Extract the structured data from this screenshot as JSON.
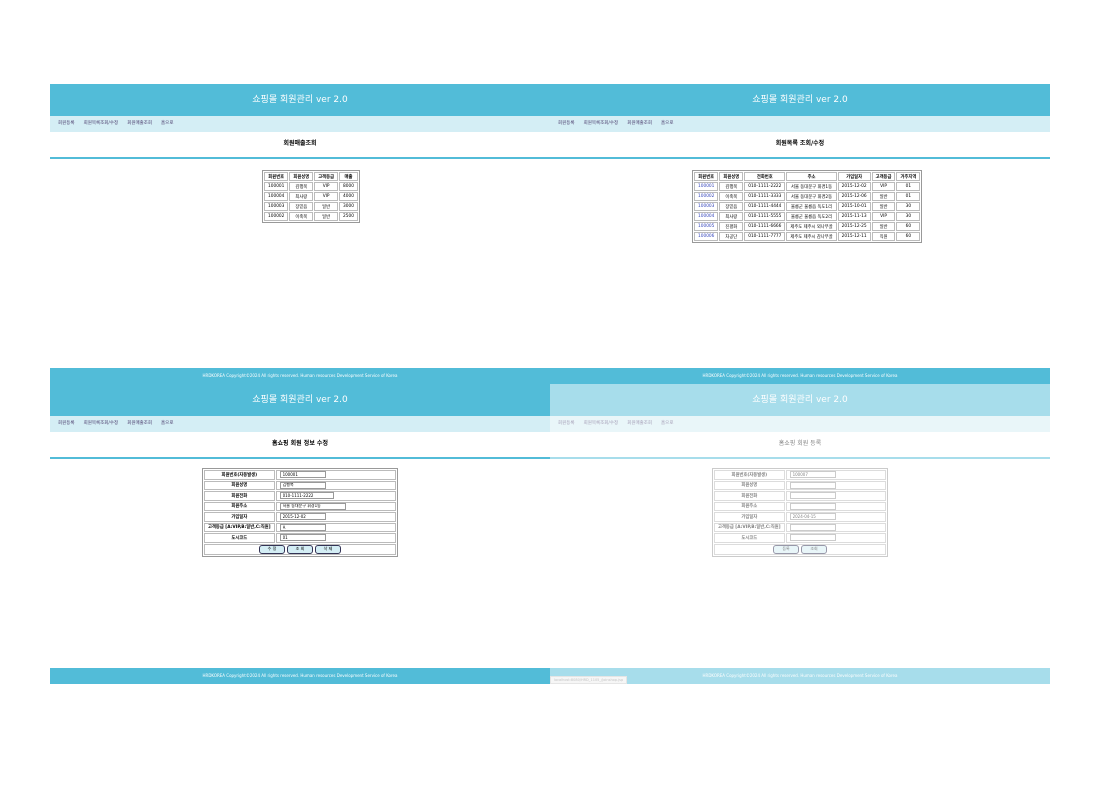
{
  "app": {
    "title": "쇼핑몰 회원관리 ver 2.0",
    "footer": "HRDKOREA Copyright©2024 All rights reserved. Human resources Development Service of Korea",
    "nav": [
      "회원등록",
      "회원목록조회/수정",
      "회원매출조회",
      "홈으로"
    ],
    "accent": "#52bcd8",
    "nav_bg": "#d4eef5"
  },
  "sales": {
    "title": "회원매출조회",
    "headers": [
      "회원번호",
      "회원성명",
      "고객등급",
      "매출"
    ],
    "rows": [
      [
        "100001",
        "김행복",
        "VIP",
        "8000"
      ],
      [
        "100004",
        "최사랑",
        "VIP",
        "4000"
      ],
      [
        "100003",
        "장믿음",
        "일반",
        "3000"
      ],
      [
        "100002",
        "이축복",
        "일반",
        "2500"
      ]
    ]
  },
  "list": {
    "title": "회원목록 조회/수정",
    "headers": [
      "회원번호",
      "회원성명",
      "전화번호",
      "주소",
      "가입일자",
      "고객등급",
      "거주지역"
    ],
    "rows": [
      [
        "100001",
        "김행복",
        "010-1111-2222",
        "서울 동대문구 휘경1동",
        "2015-12-02",
        "VIP",
        "01"
      ],
      [
        "100002",
        "이축복",
        "010-1111-3333",
        "서울 동대문구 휘경2동",
        "2015-12-06",
        "일반",
        "01"
      ],
      [
        "100003",
        "장믿음",
        "010-1111-4444",
        "울릉군 울릉읍 독도1리",
        "2015-10-01",
        "일반",
        "30"
      ],
      [
        "100004",
        "최사랑",
        "010-1111-5555",
        "울릉군 울릉읍 독도2리",
        "2015-11-13",
        "VIP",
        "30"
      ],
      [
        "100005",
        "진평화",
        "010-1111-6666",
        "제주도 제주시 외나무골",
        "2015-12-25",
        "일반",
        "60"
      ],
      [
        "100006",
        "차공단",
        "010-1111-7777",
        "제주도 제주시 감나무골",
        "2015-12-11",
        "직원",
        "60"
      ]
    ]
  },
  "edit": {
    "title": "홈쇼핑 회원 정보 수정",
    "labels": [
      "회원번호(자동발생)",
      "회원성명",
      "회원전화",
      "회원주소",
      "가입일자",
      "고객등급 [A:VIP,B:일반,C:직원]",
      "도시코드"
    ],
    "values": [
      "100001",
      "김행복",
      "010-1111-2222",
      "서울 동대문구 휘경1동",
      "2015-12-02",
      "A",
      "01"
    ],
    "buttons": [
      "수 정",
      "조 회",
      "삭 제"
    ]
  },
  "register": {
    "title": "홈쇼핑 회원 등록",
    "labels": [
      "회원번호(자동발생)",
      "회원성명",
      "회원전화",
      "회원주소",
      "가입일자",
      "고객등급 [A:VIP,B:일반,C:직원]",
      "도시코드"
    ],
    "values": [
      "100007",
      "",
      "",
      "",
      "2024-04-15",
      "",
      ""
    ],
    "buttons": [
      "등록",
      "조회"
    ],
    "status_url": "localhost:8080/HRD_1105_/joinshop.jsp"
  }
}
